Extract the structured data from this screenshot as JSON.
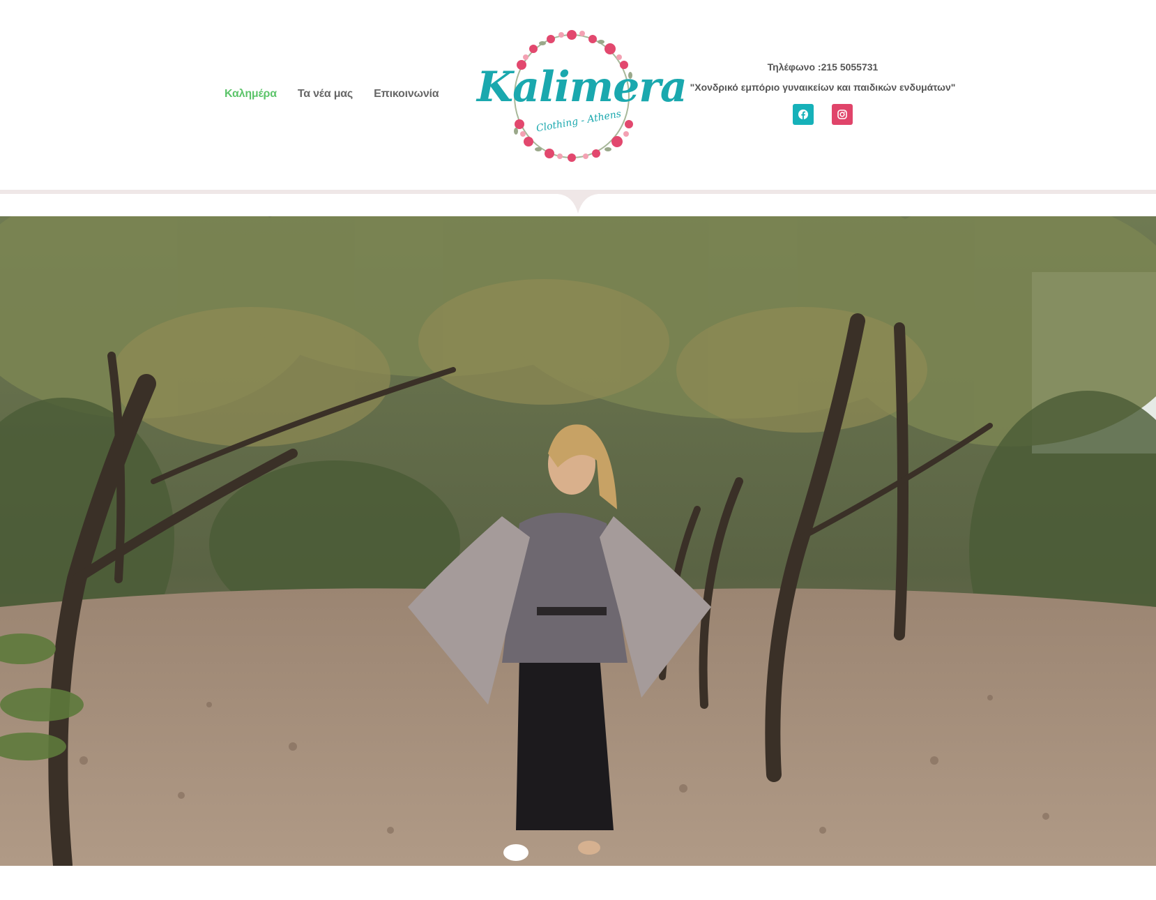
{
  "nav": {
    "items": [
      {
        "label": "Καλημέρα",
        "active": true
      },
      {
        "label": "Τα νέα μας",
        "active": false
      },
      {
        "label": "Επικοινωνία",
        "active": false
      }
    ]
  },
  "logo": {
    "title": "Kalimera",
    "subtitle": "Clothing - Athens"
  },
  "contact": {
    "phone": "Τηλέφωνο :215 5055731",
    "tagline": "\"Χονδρικό εμπόριο γυναικείων και παιδικών ενδυμάτων\""
  },
  "social": [
    {
      "icon": "facebook-icon",
      "color": "#16b1b9"
    },
    {
      "icon": "instagram-icon",
      "color": "#e0446a"
    }
  ],
  "colors": {
    "nav_active": "#5cc46a",
    "nav_text": "#666666",
    "logo_teal": "#1aa8ae",
    "logo_pink": "#e2486e",
    "divider": "#efe7e7"
  }
}
